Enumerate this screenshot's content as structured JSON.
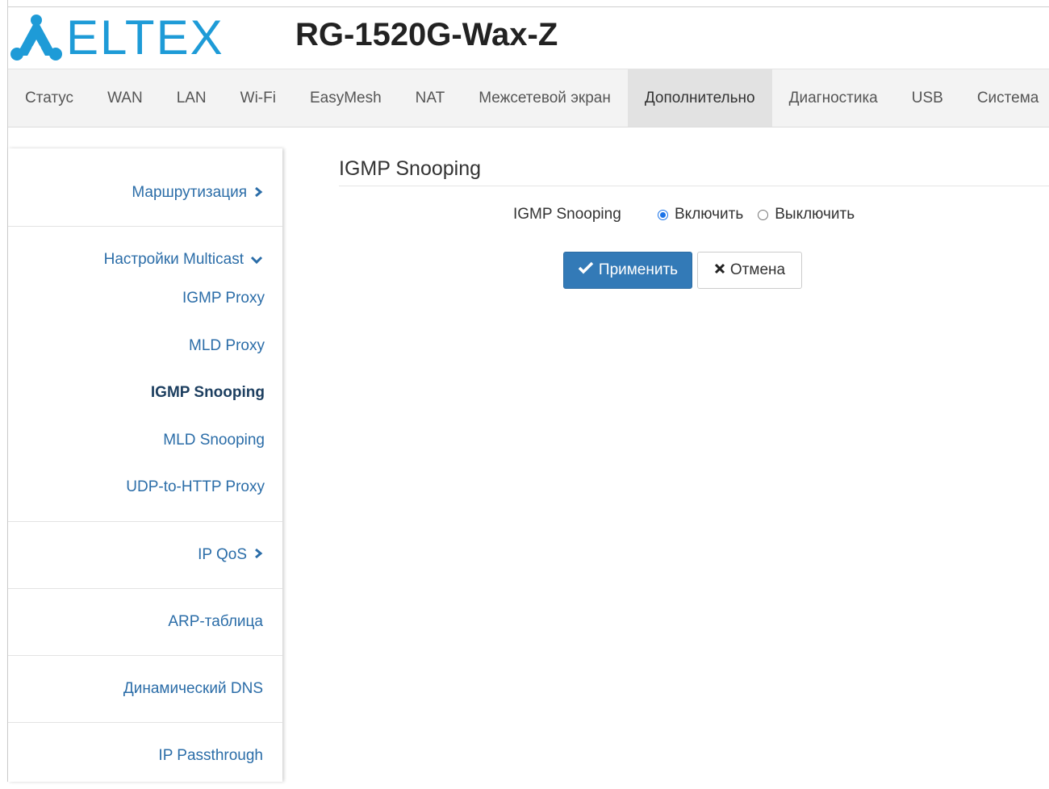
{
  "header": {
    "logo_text": "ELTEX",
    "model": "RG-1520G-Wax-Z",
    "brand_color": "#1e9bd7"
  },
  "nav": {
    "items": [
      {
        "label": "Статус",
        "active": false
      },
      {
        "label": "WAN",
        "active": false
      },
      {
        "label": "LAN",
        "active": false
      },
      {
        "label": "Wi-Fi",
        "active": false
      },
      {
        "label": "EasyMesh",
        "active": false
      },
      {
        "label": "NAT",
        "active": false
      },
      {
        "label": "Межсетевой экран",
        "active": false
      },
      {
        "label": "Дополнительно",
        "active": true
      },
      {
        "label": "Диагностика",
        "active": false
      },
      {
        "label": "USB",
        "active": false
      },
      {
        "label": "Система",
        "active": false
      }
    ]
  },
  "sidebar": {
    "routing": {
      "label": "Маршрутизация",
      "icon": "chevron-right-icon"
    },
    "multicast": {
      "label": "Настройки Multicast",
      "icon": "chevron-down-icon",
      "items": [
        {
          "label": "IGMP Proxy",
          "active": false
        },
        {
          "label": "MLD Proxy",
          "active": false
        },
        {
          "label": "IGMP Snooping",
          "active": true
        },
        {
          "label": "MLD Snooping",
          "active": false
        },
        {
          "label": "UDP-to-HTTP Proxy",
          "active": false
        }
      ]
    },
    "qos": {
      "label": "IP QoS",
      "icon": "chevron-right-icon"
    },
    "arp": {
      "label": "ARP-таблица"
    },
    "ddns": {
      "label": "Динамический DNS"
    },
    "passthrough": {
      "label": "IP Passthrough"
    }
  },
  "main": {
    "title": "IGMP Snooping",
    "field_label": "IGMP Snooping",
    "options": [
      {
        "label": "Включить",
        "selected": true
      },
      {
        "label": "Выключить",
        "selected": false
      }
    ],
    "apply_label": "Применить",
    "cancel_label": "Отмена"
  },
  "colors": {
    "accent": "#337ab7",
    "link": "#2b6da8",
    "radio": "#1a73e8"
  }
}
